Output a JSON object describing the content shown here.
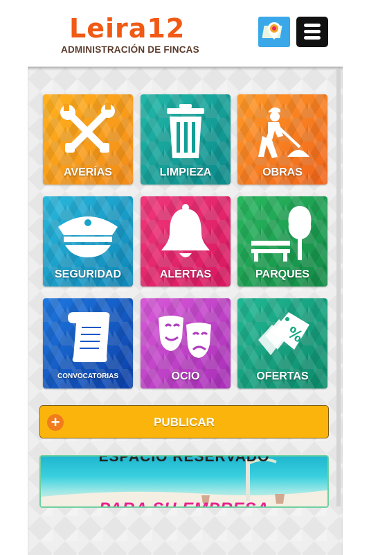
{
  "header": {
    "logo_title": "Leira12",
    "logo_subtitle": "ADMINISTRACIÓN DE FINCAS",
    "map_button": {
      "icon": "map-pin-icon",
      "color": "#3aa8e8"
    },
    "menu_button": {
      "icon": "hamburger-menu-icon",
      "color": "#111111"
    }
  },
  "tiles": [
    {
      "label": "AVERÍAS",
      "icon": "tools-icon",
      "color": "#f59a1c"
    },
    {
      "label": "LIMPIEZA",
      "icon": "trash-can-icon",
      "color": "#13a49a"
    },
    {
      "label": "OBRAS",
      "icon": "construction-worker-icon",
      "color": "#f57a1e"
    },
    {
      "label": "SEGURIDAD",
      "icon": "police-cap-icon",
      "color": "#19a3c8"
    },
    {
      "label": "ALERTAS",
      "icon": "bell-icon",
      "color": "#e8246a"
    },
    {
      "label": "PARQUES",
      "icon": "park-bench-tree-icon",
      "color": "#1ea654"
    },
    {
      "label": "CONVOCATORIAS",
      "icon": "scroll-icon",
      "color": "#1658c8"
    },
    {
      "label": "OCIO",
      "icon": "theater-masks-icon",
      "color": "#c040c8"
    },
    {
      "label": "OFERTAS",
      "icon": "discount-tags-icon",
      "color": "#17a882"
    }
  ],
  "publish": {
    "label": "PUBLICAR",
    "icon": "plus-circle-icon",
    "color": "#fbb40c"
  },
  "banner": {
    "top_text": "ESPACIO RESERVADO",
    "bottom_text": "PARA SU EMPRESA"
  }
}
